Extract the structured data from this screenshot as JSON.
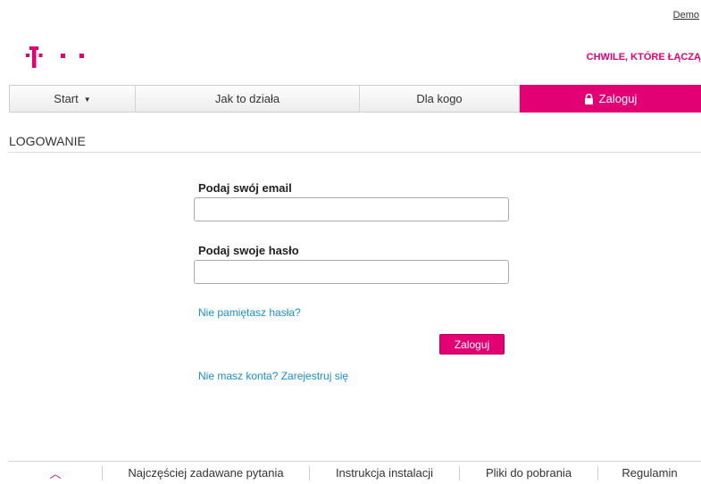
{
  "header": {
    "demo_link": "Demo",
    "tagline": "CHWILE, KTÓRE ŁĄCZĄ",
    "logo_icon": "telekom-t-logo",
    "brand_color": "#e20074"
  },
  "nav": {
    "start": "Start",
    "start_icon": "caret-down-icon",
    "how_it_works": "Jak to działa",
    "for_whom": "Dla kogo",
    "login": "Zaloguj",
    "login_icon": "lock-icon"
  },
  "page": {
    "title": "LOGOWANIE"
  },
  "form": {
    "email_label": "Podaj swój email",
    "email_value": "",
    "password_label": "Podaj swoje hasło",
    "password_value": "",
    "forgot_link": "Nie pamiętasz hasła?",
    "submit_label": "Zaloguj",
    "register_link": "Nie masz konta? Zarejestruj się"
  },
  "footer": {
    "up_icon": "chevron-up-icon",
    "up_glyph": "︿",
    "faq": "Najczęściej zadawane pytania",
    "install": "Instrukcja instalacji",
    "downloads": "Pliki do pobrania",
    "terms": "Regulamin"
  }
}
